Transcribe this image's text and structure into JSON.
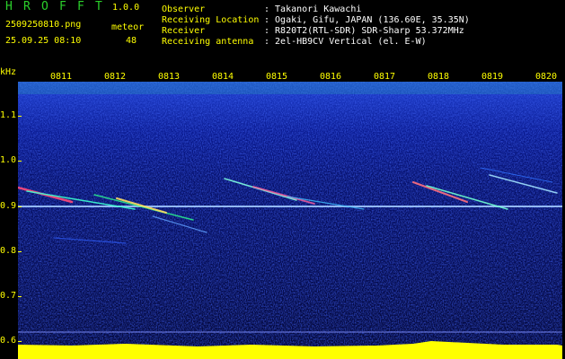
{
  "app": {
    "title_letters": [
      "H",
      "R",
      "O",
      "F",
      "F",
      "T"
    ],
    "version": "1.0.0",
    "filename": "2509250810.png",
    "datetime": "25.09.25 08:10",
    "meteor_label": "meteor",
    "meteor_count": "48"
  },
  "info": {
    "observer_label": "Observer",
    "observer_value": ": Takanori Kawachi",
    "location_label": "Receiving Location",
    "location_value": ": Ogaki, Gifu, JAPAN (136.60E, 35.35N)",
    "receiver_label": "Receiver",
    "receiver_value": ": R820T2(RTL-SDR) SDR-Sharp 53.372MHz",
    "antenna_label": "Receiving antenna",
    "antenna_value": ": 2el-HB9CV Vertical (el. E-W)"
  },
  "axis": {
    "unit": "kHz",
    "y_labels": [
      "1.1",
      "1.0",
      "0.9",
      "0.8",
      "0.7",
      "0.6"
    ],
    "time_labels": [
      "0811",
      "0812",
      "0813",
      "0814",
      "0815",
      "0816",
      "0817",
      "0818",
      "0819",
      "0820"
    ]
  },
  "colors": {
    "title": "#2bd02b",
    "header_text": "#ffff00",
    "background": "#000000",
    "carrier_line": "#a0c8ff",
    "signal_bar": "#ffff00",
    "noise_floor": "#00e5ff"
  }
}
